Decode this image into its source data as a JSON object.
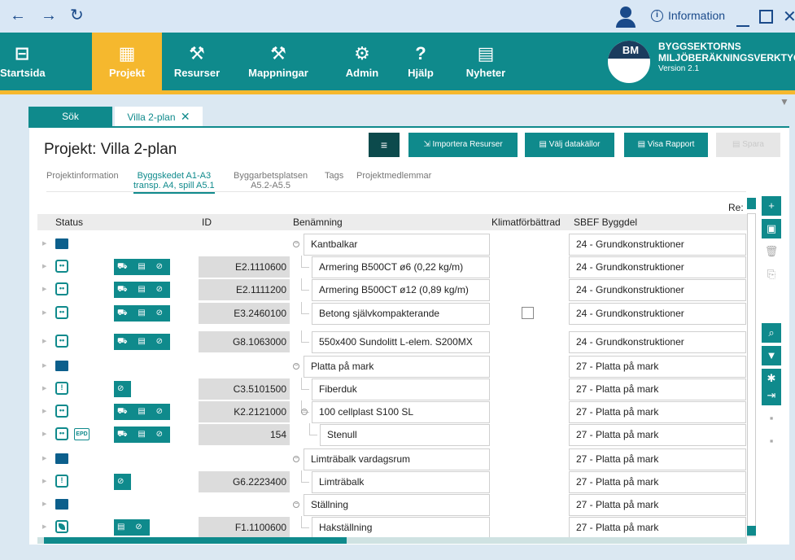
{
  "titlebar": {
    "back": "←",
    "forward": "→",
    "refresh": "↻",
    "info_label": "Information",
    "info_glyph": "i"
  },
  "nav": {
    "items": [
      {
        "label": "Startsida",
        "icon": "⊟"
      },
      {
        "label": "Projekt",
        "icon": "▦"
      },
      {
        "label": "Resurser",
        "icon": "⚒"
      },
      {
        "label": "Mappningar",
        "icon": "⚒"
      },
      {
        "label": "Admin",
        "icon": "⚙"
      },
      {
        "label": "Hjälp",
        "icon": "?"
      },
      {
        "label": "Nyheter",
        "icon": "▤"
      }
    ],
    "active": "Projekt"
  },
  "brand": {
    "logo": "BM",
    "line1": "BYGGSEKTORNS",
    "line2": "MILJÖBERÄKNINGSVERKTYG",
    "version": "Version 2.1"
  },
  "tabs": {
    "search": "Sök",
    "project": "Villa 2-plan",
    "close": "✕"
  },
  "project": {
    "title": "Projekt: Villa 2-plan",
    "menu_glyph": "≡",
    "buttons": {
      "import": "Importera Resurser",
      "sources": "Välj datakällor",
      "report": "Visa Rapport",
      "disabled": "Spara"
    }
  },
  "subtabs": [
    {
      "line1": "Projektinformation",
      "line2": ""
    },
    {
      "line1": "Byggskedet A1-A3",
      "line2": "transp. A4, spill A5.1"
    },
    {
      "line1": "Byggarbetsplatsen",
      "line2": "A5.2-A5.5"
    },
    {
      "line1": "Tags",
      "line2": ""
    },
    {
      "line1": "Projektmedlemmar",
      "line2": ""
    }
  ],
  "re_label": "Re:",
  "columns": {
    "status": "Status",
    "id": "ID",
    "name": "Benämning",
    "climate": "Klimatförbättrad",
    "sbef": "SBEF Byggdel"
  },
  "rows": [
    {
      "kind": "folder",
      "id": "",
      "name": "Kantbalkar",
      "sbef": "24 - Grundkonstruktioner"
    },
    {
      "kind": "smile",
      "tools": "⛟ ▤ ⊘",
      "id": "E2.1110600",
      "name": "Armering B500CT ø6 (0,22 kg/m)",
      "sbef": "24 - Grundkonstruktioner"
    },
    {
      "kind": "smile",
      "tools": "⛟ ▤ ⊘",
      "id": "E2.1111200",
      "name": "Armering B500CT ø12 (0,89 kg/m)",
      "sbef": "24 - Grundkonstruktioner"
    },
    {
      "kind": "smile",
      "tools": "⛟ ▤ ⊘",
      "id": "E3.2460100",
      "name": "Betong självkompakterande",
      "sbef": "24 - Grundkonstruktioner",
      "checkbox": true
    },
    {
      "kind": "smile",
      "tools": "⛟ ▤ ⊘",
      "id": "G8.1063000",
      "name": "550x400 Sundolitt L-elem. S200MX",
      "sbef": "24 - Grundkonstruktioner"
    },
    {
      "kind": "folder",
      "id": "",
      "name": "Platta på mark",
      "sbef": "27 - Platta på mark"
    },
    {
      "kind": "warn",
      "tools": "⊘",
      "id": "C3.5101500",
      "name": "Fiberduk",
      "sbef": "27 - Platta på mark"
    },
    {
      "kind": "smile",
      "tools": "⛟ ▤ ⊘",
      "id": "K2.2121000",
      "name": "100 cellplast S100 SL",
      "sbef": "27 - Platta på mark"
    },
    {
      "kind": "smile-epd",
      "tools": "⛟ ▤ ⊘",
      "epd": "EPD",
      "id": "154",
      "name": "Stenull",
      "sbef": "27 - Platta på mark"
    },
    {
      "kind": "folder",
      "id": "",
      "name": "Limträbalk vardagsrum",
      "sbef": "27 - Platta på mark"
    },
    {
      "kind": "warn",
      "tools": "⊘",
      "id": "G6.2223400",
      "name": "Limträbalk",
      "sbef": "27 - Platta på mark"
    },
    {
      "kind": "folder",
      "id": "",
      "name": "Ställning",
      "sbef": "27 - Platta på mark"
    },
    {
      "kind": "leaf",
      "tools": "▤ ⊘",
      "id": "F1.1100600",
      "name": "Hakställning",
      "sbef": "27 - Platta på mark"
    }
  ],
  "status_glyphs": {
    "smile": "••",
    "warn": "!"
  },
  "right_toolbar": [
    "+",
    "▣",
    "🗑",
    "⎘",
    "⌕",
    "▼",
    "✱",
    "⇥",
    "▪",
    "▪"
  ],
  "colors": {
    "teal": "#0f8a8c",
    "gold": "#f5b82e",
    "dark_teal": "#0c4a4c"
  }
}
